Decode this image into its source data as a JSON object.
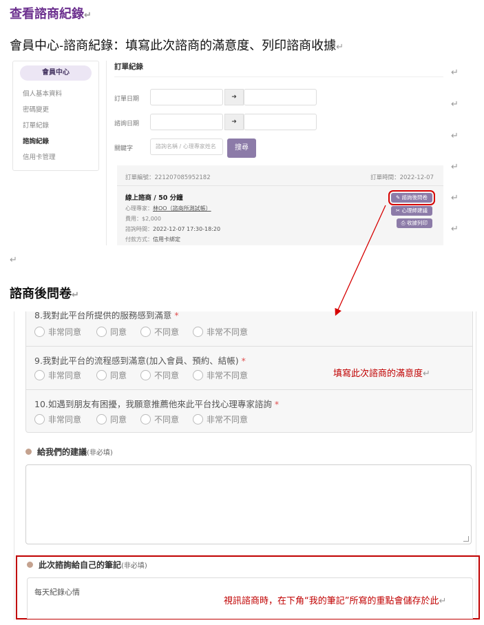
{
  "doc": {
    "title": "查看諮商紀錄",
    "subtitle": "會員中心-諮商紀錄：填寫此次諮商的滿意度、列印諮商收據",
    "section_title": "諮商後問卷",
    "return_mark": "↵"
  },
  "sidebar": {
    "header": "會員中心",
    "items": [
      {
        "label": "個人基本資料",
        "active": false
      },
      {
        "label": "密碼變更",
        "active": false
      },
      {
        "label": "訂單紀錄",
        "active": false
      },
      {
        "label": "諮詢紀錄",
        "active": true
      },
      {
        "label": "信用卡管理",
        "active": false
      }
    ]
  },
  "filters": {
    "title": "訂單紀錄",
    "order_date_label": "訂單日期",
    "consult_date_label": "諮詢日期",
    "keyword_label": "關鍵字",
    "keyword_placeholder": "諮詢名稱 / 心理專家姓名",
    "arrow": "➜",
    "search_button": "搜尋"
  },
  "order": {
    "number": "訂單編號：221207085952182",
    "time": "訂單時間：2022-12-07",
    "name": "線上諮商 / 50 分鐘",
    "expert_label": "心理專家：",
    "expert": "林OO（諮商所測試帳）",
    "fee": "費用：$2,000",
    "consult_label": "諮詢時間：",
    "consult_time": "2022-12-07 17:30-18:20",
    "payment_label": "付款方式：",
    "payment": "信用卡綁定",
    "btn_survey": "諮詢後問卷",
    "btn_advice": "心理師建議",
    "btn_receipt": "收據列印"
  },
  "survey": {
    "q8": "8.我對此平台所提供的服務感到滿意",
    "q9": "9.我對此平台的流程感到滿意(加入會員、預約、結帳)",
    "q10": "10.如遇到朋友有困擾，我願意推薦他來此平台找心理專家諮詢",
    "required": "*",
    "options": [
      "非常同意",
      "同意",
      "不同意",
      "非常不同意"
    ],
    "annotation": "填寫此次諮商的滿意度",
    "suggest_label": "給我們的建議",
    "optional_note": "(非必填)",
    "notes_label": "此次諮詢給自己的筆記",
    "notes_value": "每天紀錄心情",
    "notes_annotation": "視訊諮商時，在下角“我的筆記”所寫的重點會儲存於此"
  },
  "colors": {
    "title_purple": "#6b2f8e",
    "button_purple": "#8c7ba8",
    "annotation_red": "#c00000",
    "bullet": "#c4a28f"
  }
}
